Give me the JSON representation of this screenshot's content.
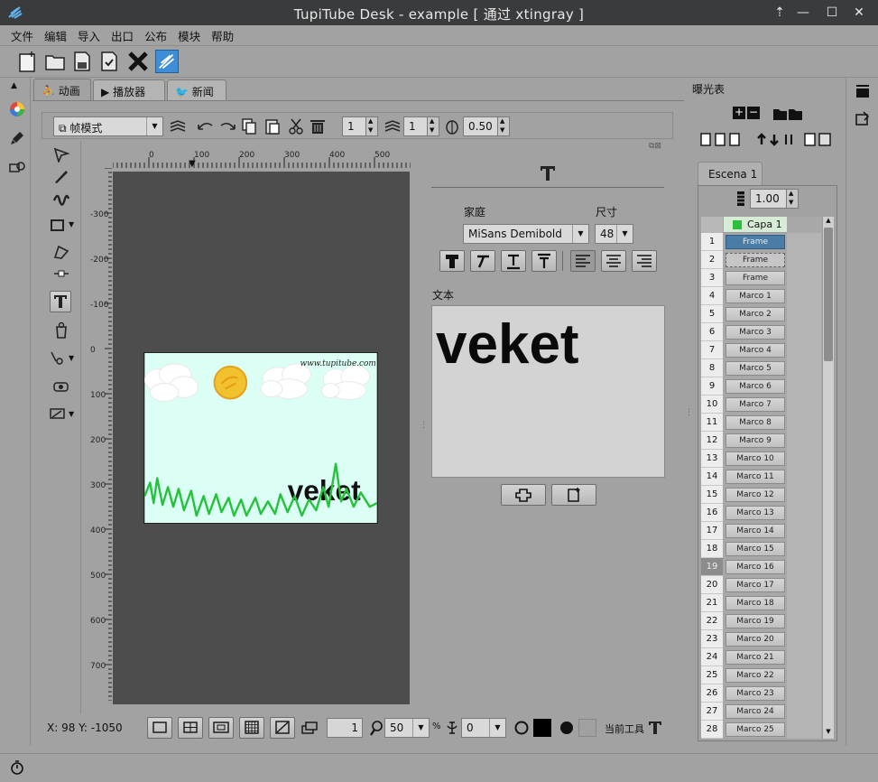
{
  "window": {
    "title": "TupiTube Desk - example [ 通过 xtingray ]",
    "controls": [
      "minimize",
      "restore",
      "maximize",
      "close"
    ]
  },
  "menu": [
    "文件",
    "编辑",
    "导入",
    "出口",
    "公布",
    "模块",
    "帮助"
  ],
  "tabs": [
    {
      "label": "动画",
      "selected": true
    },
    {
      "label": "播放器",
      "selected": false
    },
    {
      "label": "新闻",
      "selected": false
    }
  ],
  "canvas_toolbar": {
    "mode": "帧模式",
    "spin1": "1",
    "spin2": "1",
    "opacity": "0.50"
  },
  "ruler": {
    "h_labels": [
      "0",
      "100",
      "200",
      "300",
      "400",
      "500"
    ],
    "v_labels": [
      "-300",
      "-200",
      "-100",
      "0",
      "100",
      "200",
      "300",
      "400",
      "500",
      "600",
      "700"
    ]
  },
  "scene_text": {
    "url": "www.tupitube.com",
    "word": "veket"
  },
  "text_panel": {
    "family_label": "家庭",
    "size_label": "尺寸",
    "family": "MiSans Demibold",
    "size": "48",
    "text_label": "文本",
    "text": "veket"
  },
  "status": {
    "coords": "X: 98 Y: -1050",
    "frame": "1",
    "zoom": "50",
    "zoom_unit": "%",
    "rotation": "0",
    "current_tool_label": "当前工具"
  },
  "exposure": {
    "title": "曝光表",
    "scene_tab": "Escena 1",
    "fps": "1.00",
    "layer": "Capa 1",
    "layer_color": "#2bbf3a",
    "selected_row": 19,
    "rows": [
      {
        "n": "1",
        "frame": "Frame",
        "state": "current"
      },
      {
        "n": "2",
        "frame": "Frame",
        "state": "empty"
      },
      {
        "n": "3",
        "frame": "Frame",
        "state": "normal"
      },
      {
        "n": "4",
        "frame": "Marco 1",
        "state": "normal"
      },
      {
        "n": "5",
        "frame": "Marco 2",
        "state": "normal"
      },
      {
        "n": "6",
        "frame": "Marco 3",
        "state": "normal"
      },
      {
        "n": "7",
        "frame": "Marco 4",
        "state": "normal"
      },
      {
        "n": "8",
        "frame": "Marco 5",
        "state": "normal"
      },
      {
        "n": "9",
        "frame": "Marco 6",
        "state": "normal"
      },
      {
        "n": "10",
        "frame": "Marco 7",
        "state": "normal"
      },
      {
        "n": "11",
        "frame": "Marco 8",
        "state": "normal"
      },
      {
        "n": "12",
        "frame": "Marco 9",
        "state": "normal"
      },
      {
        "n": "13",
        "frame": "Marco 10",
        "state": "normal"
      },
      {
        "n": "14",
        "frame": "Marco 11",
        "state": "normal"
      },
      {
        "n": "15",
        "frame": "Marco 12",
        "state": "normal"
      },
      {
        "n": "16",
        "frame": "Marco 13",
        "state": "normal"
      },
      {
        "n": "17",
        "frame": "Marco 14",
        "state": "normal"
      },
      {
        "n": "18",
        "frame": "Marco 15",
        "state": "normal"
      },
      {
        "n": "19",
        "frame": "Marco 16",
        "state": "normal"
      },
      {
        "n": "20",
        "frame": "Marco 17",
        "state": "normal"
      },
      {
        "n": "21",
        "frame": "Marco 18",
        "state": "normal"
      },
      {
        "n": "22",
        "frame": "Marco 19",
        "state": "normal"
      },
      {
        "n": "23",
        "frame": "Marco 20",
        "state": "normal"
      },
      {
        "n": "24",
        "frame": "Marco 21",
        "state": "normal"
      },
      {
        "n": "25",
        "frame": "Marco 22",
        "state": "normal"
      },
      {
        "n": "26",
        "frame": "Marco 23",
        "state": "normal"
      },
      {
        "n": "27",
        "frame": "Marco 24",
        "state": "normal"
      },
      {
        "n": "28",
        "frame": "Marco 25",
        "state": "normal"
      }
    ]
  }
}
